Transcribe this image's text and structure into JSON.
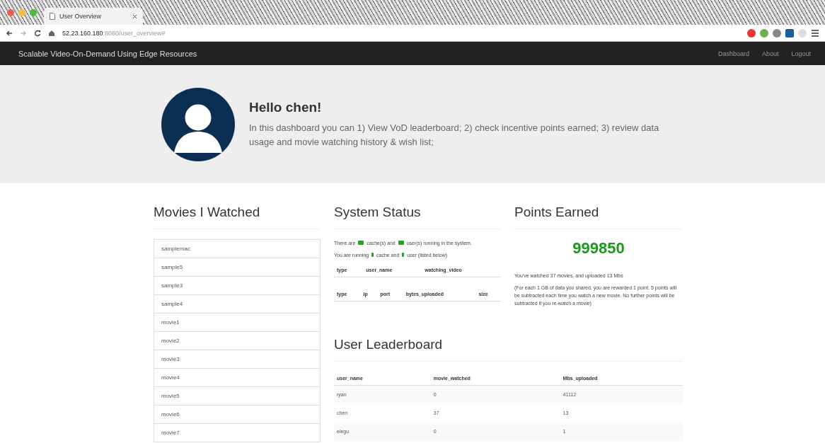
{
  "browser": {
    "tab_title": "User Overview",
    "url_host": "52.23.160.180",
    "url_rest": ":8080/user_overview#"
  },
  "navbar": {
    "brand": "Scalable Video-On-Demand Using Edge Resources",
    "links": [
      "Dashboard",
      "About",
      "Logout"
    ]
  },
  "jumbotron": {
    "greeting": "Hello chen!",
    "intro": "In this dashboard you can 1) View VoD leaderboard; 2) check incentive points earned; 3) review data usage and movie watching history & wish list;"
  },
  "movies": {
    "title": "Movies I Watched",
    "items": [
      "samplemac",
      "sample5",
      "sample3",
      "sample4",
      "movie1",
      "movie2",
      "movie3",
      "movie4",
      "movie5",
      "movie6",
      "movie7"
    ]
  },
  "system_status": {
    "title": "System Status",
    "line1": [
      "There are",
      "cache(s) and",
      "user(s) running in the system."
    ],
    "line2": [
      "You are running",
      "cache and",
      "user (listed below)"
    ],
    "table1_columns": [
      "type",
      "user_name",
      "watching_video"
    ],
    "table2_columns": [
      "type",
      "ip",
      "port",
      "bytes_uploaded",
      "size"
    ]
  },
  "points": {
    "title": "Points Earned",
    "value": "999850",
    "summary": "You've watched 37 movies, and uploaded 13 Mbs",
    "note": "(For each 1 GB of data you shared, you are rewarded 1 point. 5 points will be subtracted each time you watch a new movie. No further points will be subtracted if you re-watch a movie)"
  },
  "leaderboard": {
    "title": "User Leaderboard",
    "columns": [
      "user_name",
      "movie_watched",
      "Mbs_uploaded"
    ],
    "rows": [
      [
        "ryan",
        "0",
        "41112"
      ],
      [
        "chen",
        "37",
        "13"
      ],
      [
        "elegu",
        "0",
        "1"
      ]
    ]
  }
}
